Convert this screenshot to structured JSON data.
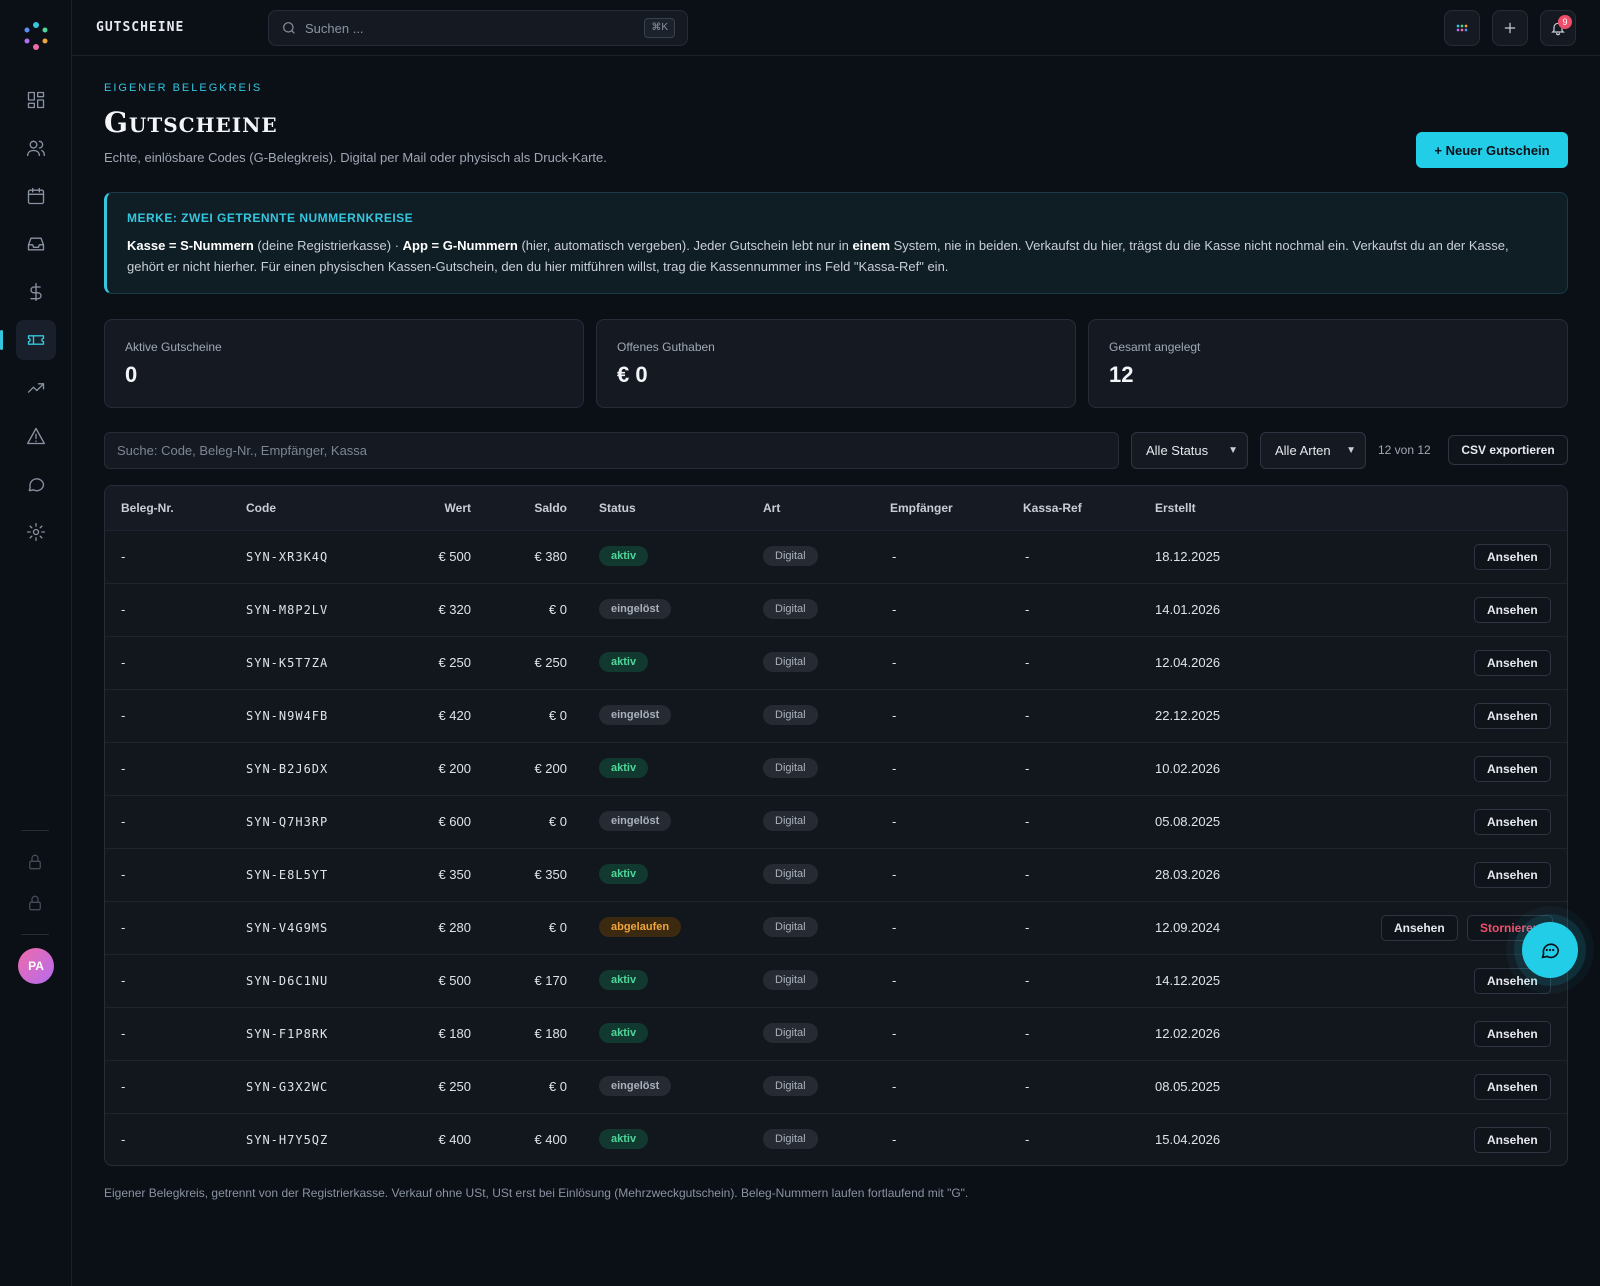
{
  "topbar": {
    "title": "GUTSCHEINE",
    "search_placeholder": "Suchen ...",
    "search_shortcut": "⌘K",
    "notification_count": "9"
  },
  "header": {
    "eyebrow": "EIGENER BELEGKREIS",
    "title": "Gutscheine",
    "subtitle": "Echte, einlösbare Codes (G-Belegkreis). Digital per Mail oder physisch als Druck-Karte.",
    "new_button": "+ Neuer Gutschein"
  },
  "notice": {
    "title": "MERKE: ZWEI GETRENNTE NUMMERNKREISE",
    "b1": "Kasse = S-Nummern",
    "t1": " (deine Registrierkasse) · ",
    "b2": "App = G-Nummern",
    "t2": " (hier, automatisch vergeben). Jeder Gutschein lebt nur in ",
    "b3": "einem",
    "t3": " System, nie in beiden. Verkaufst du hier, trägst du die Kasse nicht nochmal ein. Verkaufst du an der Kasse, gehört er nicht hierher. Für einen physischen Kassen-Gutschein, den du hier mitführen willst, trag die Kassennummer ins Feld \"Kassa-Ref\" ein."
  },
  "stats": [
    {
      "label": "Aktive Gutscheine",
      "value": "0"
    },
    {
      "label": "Offenes Guthaben",
      "value": "€ 0"
    },
    {
      "label": "Gesamt angelegt",
      "value": "12"
    }
  ],
  "filters": {
    "search_placeholder": "Suche: Code, Beleg-Nr., Empfänger, Kassa",
    "status": "Alle Status",
    "art": "Alle Arten",
    "count": "12 von 12",
    "export": "CSV exportieren"
  },
  "table": {
    "headers": [
      "Beleg-Nr.",
      "Code",
      "Wert",
      "Saldo",
      "Status",
      "Art",
      "Empfänger",
      "Kassa-Ref",
      "Erstellt"
    ],
    "view_label": "Ansehen",
    "cancel_label": "Stornieren",
    "rows": [
      {
        "beleg": "-",
        "code": "SYN-XR3K4Q",
        "wert": "€ 500",
        "saldo": "€ 380",
        "status": "aktiv",
        "art": "Digital",
        "empf": "-",
        "kassa": "-",
        "erstellt": "18.12.2025"
      },
      {
        "beleg": "-",
        "code": "SYN-M8P2LV",
        "wert": "€ 320",
        "saldo": "€ 0",
        "status": "eingelöst",
        "art": "Digital",
        "empf": "-",
        "kassa": "-",
        "erstellt": "14.01.2026"
      },
      {
        "beleg": "-",
        "code": "SYN-K5T7ZA",
        "wert": "€ 250",
        "saldo": "€ 250",
        "status": "aktiv",
        "art": "Digital",
        "empf": "-",
        "kassa": "-",
        "erstellt": "12.04.2026"
      },
      {
        "beleg": "-",
        "code": "SYN-N9W4FB",
        "wert": "€ 420",
        "saldo": "€ 0",
        "status": "eingelöst",
        "art": "Digital",
        "empf": "-",
        "kassa": "-",
        "erstellt": "22.12.2025"
      },
      {
        "beleg": "-",
        "code": "SYN-B2J6DX",
        "wert": "€ 200",
        "saldo": "€ 200",
        "status": "aktiv",
        "art": "Digital",
        "empf": "-",
        "kassa": "-",
        "erstellt": "10.02.2026"
      },
      {
        "beleg": "-",
        "code": "SYN-Q7H3RP",
        "wert": "€ 600",
        "saldo": "€ 0",
        "status": "eingelöst",
        "art": "Digital",
        "empf": "-",
        "kassa": "-",
        "erstellt": "05.08.2025"
      },
      {
        "beleg": "-",
        "code": "SYN-E8L5YT",
        "wert": "€ 350",
        "saldo": "€ 350",
        "status": "aktiv",
        "art": "Digital",
        "empf": "-",
        "kassa": "-",
        "erstellt": "28.03.2026"
      },
      {
        "beleg": "-",
        "code": "SYN-V4G9MS",
        "wert": "€ 280",
        "saldo": "€ 0",
        "status": "abgelaufen",
        "art": "Digital",
        "empf": "-",
        "kassa": "-",
        "erstellt": "12.09.2024"
      },
      {
        "beleg": "-",
        "code": "SYN-D6C1NU",
        "wert": "€ 500",
        "saldo": "€ 170",
        "status": "aktiv",
        "art": "Digital",
        "empf": "-",
        "kassa": "-",
        "erstellt": "14.12.2025"
      },
      {
        "beleg": "-",
        "code": "SYN-F1P8RK",
        "wert": "€ 180",
        "saldo": "€ 180",
        "status": "aktiv",
        "art": "Digital",
        "empf": "-",
        "kassa": "-",
        "erstellt": "12.02.2026"
      },
      {
        "beleg": "-",
        "code": "SYN-G3X2WC",
        "wert": "€ 250",
        "saldo": "€ 0",
        "status": "eingelöst",
        "art": "Digital",
        "empf": "-",
        "kassa": "-",
        "erstellt": "08.05.2025"
      },
      {
        "beleg": "-",
        "code": "SYN-H7Y5QZ",
        "wert": "€ 400",
        "saldo": "€ 400",
        "status": "aktiv",
        "art": "Digital",
        "empf": "-",
        "kassa": "-",
        "erstellt": "15.04.2026"
      }
    ]
  },
  "footnote": "Eigener Belegkreis, getrennt von der Registrierkasse. Verkauf ohne USt, USt erst bei Einlösung (Mehrzweckgutschein). Beleg-Nummern laufen fortlaufend mit \"G\".",
  "sidebar": {
    "avatar_initials": "PA",
    "icons": [
      "dashboard-icon",
      "users-icon",
      "calendar-icon",
      "inbox-icon",
      "dollar-icon",
      "ticket-icon",
      "trending-icon",
      "alert-icon",
      "chat-icon",
      "settings-icon",
      "lock-icon",
      "lock-icon"
    ]
  },
  "colors": {
    "accent": "#22cde8",
    "background": "#0b0f16",
    "status_aktiv": "#4fd69a",
    "status_abgelaufen": "#f0a53a",
    "danger": "#f0506d"
  }
}
